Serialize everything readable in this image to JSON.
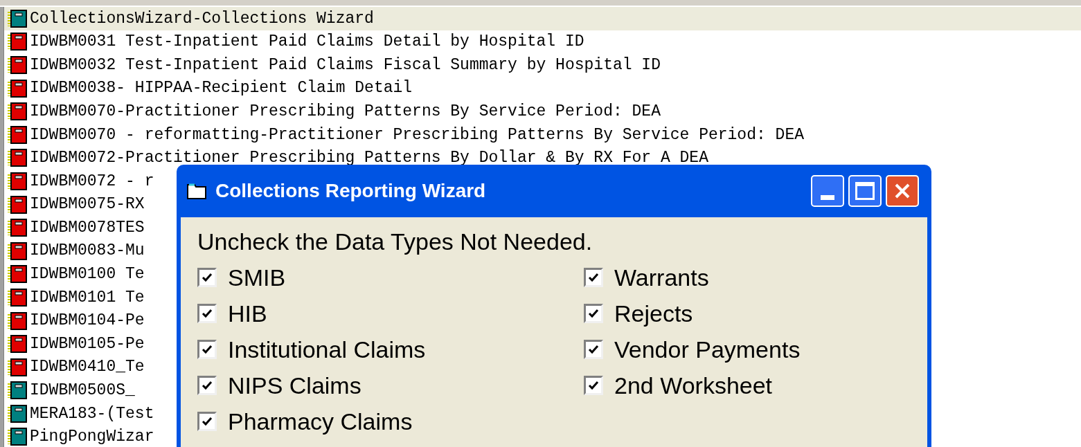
{
  "list": {
    "items": [
      {
        "label": "CollectionsWizard-Collections Wizard",
        "color": "#008080",
        "selected": true
      },
      {
        "label": "IDWBM0031 Test-Inpatient Paid Claims Detail by Hospital ID",
        "color": "#e00000",
        "selected": false
      },
      {
        "label": "IDWBM0032 Test-Inpatient Paid Claims Fiscal Summary by Hospital ID",
        "color": "#e00000",
        "selected": false
      },
      {
        "label": "IDWBM0038- HIPPAA-Recipient Claim Detail",
        "color": "#e00000",
        "selected": false
      },
      {
        "label": "IDWBM0070-Practitioner Prescribing Patterns By Service Period: DEA",
        "color": "#e00000",
        "selected": false
      },
      {
        "label": "IDWBM0070 - reformatting-Practitioner Prescribing Patterns By Service Period: DEA",
        "color": "#e00000",
        "selected": false
      },
      {
        "label": "IDWBM0072-Practitioner Prescribing Patterns By Dollar & By RX For A DEA",
        "color": "#e00000",
        "selected": false
      },
      {
        "label": "IDWBM0072 - r",
        "color": "#e00000",
        "selected": false
      },
      {
        "label": "IDWBM0075-RX",
        "color": "#e00000",
        "selected": false
      },
      {
        "label": "IDWBM0078TES",
        "color": "#e00000",
        "selected": false
      },
      {
        "label": "IDWBM0083-Mu",
        "color": "#e00000",
        "selected": false
      },
      {
        "label": "IDWBM0100 Te",
        "color": "#e00000",
        "selected": false
      },
      {
        "label": "IDWBM0101 Te",
        "color": "#e00000",
        "selected": false
      },
      {
        "label": "IDWBM0104-Pe",
        "color": "#e00000",
        "selected": false
      },
      {
        "label": "IDWBM0105-Pe",
        "color": "#e00000",
        "selected": false
      },
      {
        "label": "IDWBM0410_Te",
        "color": "#e00000",
        "selected": false
      },
      {
        "label": "IDWBM0500S_",
        "color": "#008080",
        "selected": false
      },
      {
        "label": "MERA183-(Test",
        "color": "#008080",
        "selected": false
      },
      {
        "label": "PingPongWizar",
        "color": "#008080",
        "selected": false
      }
    ]
  },
  "dialog": {
    "title": "Collections Reporting Wizard",
    "instruction": "Uncheck the Data Types Not Needed.",
    "left_options": [
      {
        "label": "SMIB",
        "checked": true
      },
      {
        "label": "HIB",
        "checked": true
      },
      {
        "label": "Institutional Claims",
        "checked": true
      },
      {
        "label": "NIPS Claims",
        "checked": true
      },
      {
        "label": "Pharmacy Claims",
        "checked": true
      }
    ],
    "right_options": [
      {
        "label": "Warrants",
        "checked": true
      },
      {
        "label": "Rejects",
        "checked": true
      },
      {
        "label": "Vendor Payments",
        "checked": true
      },
      {
        "label": "2nd Worksheet",
        "checked": true
      }
    ]
  }
}
